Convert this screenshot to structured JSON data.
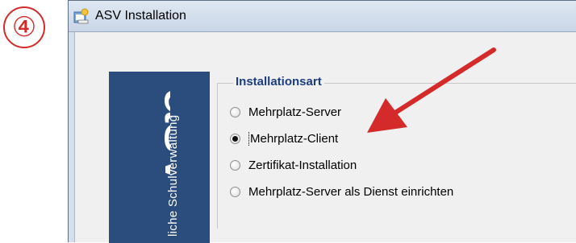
{
  "step_marker": "④",
  "window": {
    "title": "ASV Installation"
  },
  "brand": {
    "logo_text": "asv",
    "subtitle": "liche Schulverwaltung"
  },
  "installation_type": {
    "group_title": "Installationsart",
    "options": [
      {
        "label": "Mehrplatz-Server",
        "selected": false
      },
      {
        "label": "Mehrplatz-Client",
        "selected": true
      },
      {
        "label": "Zertifikat-Installation",
        "selected": false
      },
      {
        "label": "Mehrplatz-Server als Dienst einrichten",
        "selected": false
      }
    ]
  },
  "colors": {
    "annotation_red": "#d42a2a",
    "brand_blue": "#2b4d7d",
    "group_title_blue": "#1b3d80"
  }
}
